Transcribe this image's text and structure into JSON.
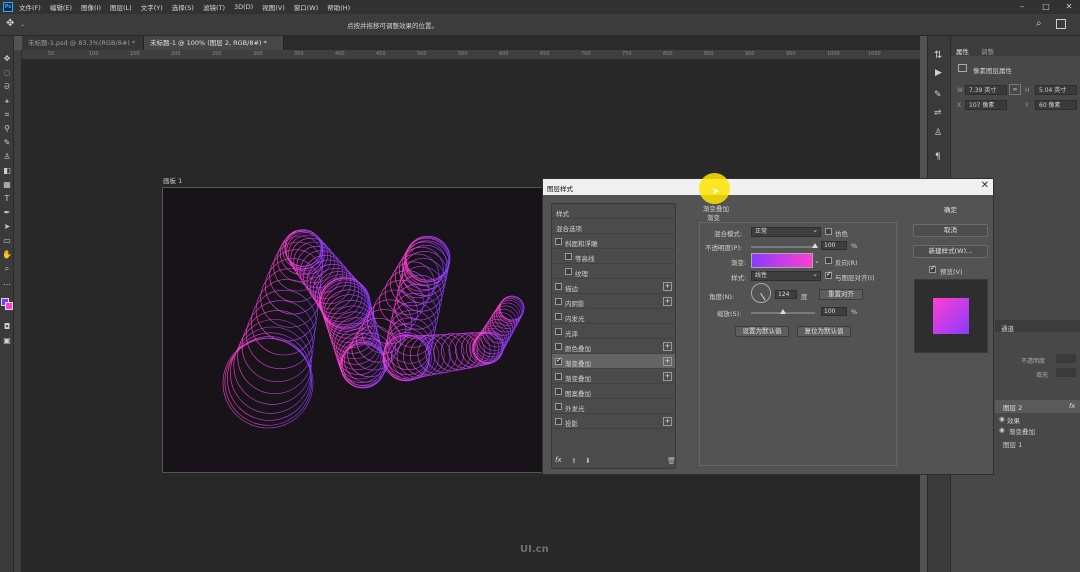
{
  "menubar": {
    "logo": "Ps",
    "items": [
      "文件(F)",
      "编辑(E)",
      "图像(I)",
      "图层(L)",
      "文字(Y)",
      "选择(S)",
      "滤镜(T)",
      "3D(D)",
      "视图(V)",
      "窗口(W)",
      "帮助(H)"
    ]
  },
  "optbar": {
    "hint": "点按并拖移可调整效果的位置。"
  },
  "tabs": [
    {
      "label": "未标题-1.psd @ 83.3%(RGB/8#) *"
    },
    {
      "label": "未标题-1 @ 100% (图层 2, RGB/8#) *"
    }
  ],
  "ruler": {
    "ticks": [
      "50",
      "100",
      "150",
      "200",
      "250",
      "300",
      "350",
      "400",
      "450",
      "500",
      "550",
      "600",
      "650",
      "700",
      "750",
      "800",
      "850",
      "900",
      "950",
      "1000",
      "1050"
    ]
  },
  "canvas": {
    "artboard_label": "画板 1",
    "watermark": "UI.cn",
    "gradient_colors": [
      "#ff3fd0",
      "#8a3bff"
    ]
  },
  "right_panel": {
    "tabs": [
      "属性",
      "调整"
    ],
    "section": "像素图层属性",
    "w_label": "W",
    "w_value": "7.39 英寸",
    "h_label": "H",
    "h_value": "5.04 英寸",
    "x_label": "X",
    "x_value": "107 像素",
    "y_label": "Y",
    "y_value": "60 像素",
    "layers_tab": "通道",
    "opacity_label": "不透明度",
    "fill_label": "填充",
    "layer_name": "图层 2",
    "fx": "fx",
    "effects_label": "效果",
    "effect_item": "渐变叠加",
    "bg_layer": "图层 1"
  },
  "dialog": {
    "title": "图层样式",
    "close": "✕",
    "styles": [
      {
        "label": "样式",
        "checkbox": false,
        "plus": false,
        "checked": false,
        "selected": false,
        "header": true
      },
      {
        "label": "混合选项",
        "checkbox": false,
        "plus": false,
        "checked": false,
        "selected": false,
        "header": true
      },
      {
        "label": "斜面和浮雕",
        "checkbox": true,
        "plus": false,
        "checked": false,
        "selected": false
      },
      {
        "label": "等高线",
        "checkbox": true,
        "plus": false,
        "checked": false,
        "selected": false,
        "indent": true
      },
      {
        "label": "纹理",
        "checkbox": true,
        "plus": false,
        "checked": false,
        "selected": false,
        "indent": true
      },
      {
        "label": "描边",
        "checkbox": true,
        "plus": true,
        "checked": false,
        "selected": false
      },
      {
        "label": "内阴影",
        "checkbox": true,
        "plus": true,
        "checked": false,
        "selected": false
      },
      {
        "label": "内发光",
        "checkbox": true,
        "plus": false,
        "checked": false,
        "selected": false
      },
      {
        "label": "光泽",
        "checkbox": true,
        "plus": false,
        "checked": false,
        "selected": false
      },
      {
        "label": "颜色叠加",
        "checkbox": true,
        "plus": true,
        "checked": false,
        "selected": false
      },
      {
        "label": "渐变叠加",
        "checkbox": true,
        "plus": true,
        "checked": true,
        "selected": true
      },
      {
        "label": "渐变叠加",
        "checkbox": true,
        "plus": true,
        "checked": false,
        "selected": false
      },
      {
        "label": "图案叠加",
        "checkbox": true,
        "plus": false,
        "checked": false,
        "selected": false
      },
      {
        "label": "外发光",
        "checkbox": true,
        "plus": false,
        "checked": false,
        "selected": false
      },
      {
        "label": "投影",
        "checkbox": true,
        "plus": true,
        "checked": false,
        "selected": false
      }
    ],
    "footer_fx": "fx",
    "section_title": "渐变叠加",
    "section_sub": "渐变",
    "blend_mode_label": "混合模式:",
    "blend_mode_value": "正常",
    "dither_label": "仿色",
    "opacity_label": "不透明度(P):",
    "opacity_value": "100",
    "opacity_unit": "%",
    "opacity_level": 1.0,
    "gradient_label": "渐变:",
    "reverse_label": "反向(R)",
    "style_label": "样式:",
    "style_value": "线性",
    "align_label": "与图层对齐(I)",
    "angle_label": "角度(N):",
    "angle_value": "124",
    "angle_unit": "度",
    "reset_align_btn": "重置对齐",
    "scale_label": "缩放(S):",
    "scale_value": "100",
    "scale_unit": "%",
    "scale_level": 0.5,
    "set_default_btn": "设置为默认值",
    "reset_default_btn": "复位为默认值",
    "ok_btn": "确定",
    "cancel_btn": "取消",
    "new_style_btn": "新建样式(W)...",
    "preview_label": "预览(V)"
  }
}
